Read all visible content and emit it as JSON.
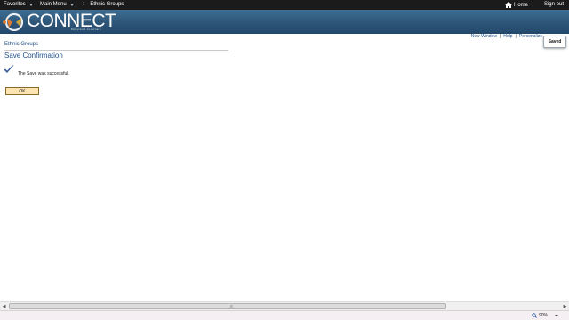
{
  "topnav": {
    "favorites": "Favorites",
    "main_menu": "Main Menu",
    "breadcrumb": "Ethnic Groups",
    "home": "Home",
    "sign_out": "Sign out"
  },
  "banner": {
    "logo_text": "CONNECT",
    "logo_sub": "Maryland Judiciary"
  },
  "utility_links": {
    "new_window": "New Window",
    "help": "Help",
    "personalize": "Personalize",
    "separator": "|"
  },
  "saved_button": "Saved",
  "page": {
    "component_title": "Ethnic Groups",
    "title": "Save Confirmation",
    "message": "The Save was successful.",
    "ok_label": "OK"
  },
  "status": {
    "zoom": "90%"
  },
  "icons": [
    "chevron-down-icon",
    "chevron-right-icon",
    "home-icon",
    "checkmark-icon",
    "magnifier-icon"
  ],
  "colors": {
    "nav_bg": "#1b1b1b",
    "banner_bg": "#2d5578",
    "link": "#1f4f8b",
    "ok_button": "#fbe4b0"
  }
}
